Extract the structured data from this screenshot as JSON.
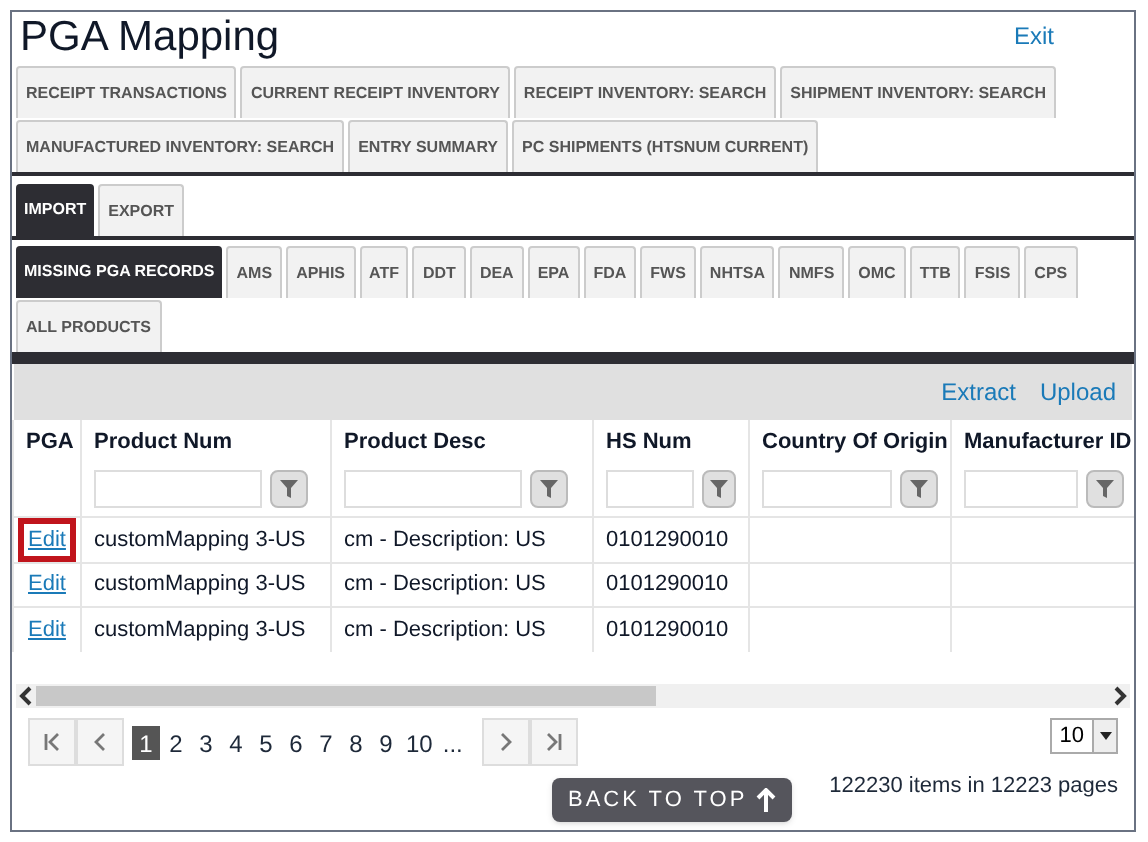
{
  "window": {
    "title": "PGA Mapping",
    "exit_link": "Exit"
  },
  "main_tabs": [
    {
      "label": "RECEIPT TRANSACTIONS",
      "selected": false
    },
    {
      "label": "CURRENT RECEIPT INVENTORY",
      "selected": false
    },
    {
      "label": "RECEIPT INVENTORY: SEARCH",
      "selected": false
    },
    {
      "label": "SHIPMENT INVENTORY: SEARCH",
      "selected": false
    },
    {
      "label": "MANUFACTURED INVENTORY: SEARCH",
      "selected": false
    },
    {
      "label": "ENTRY SUMMARY",
      "selected": false
    },
    {
      "label": "PC SHIPMENTS (HTSNUM CURRENT)",
      "selected": false
    }
  ],
  "direction_tabs": [
    {
      "label": "IMPORT",
      "selected": true
    },
    {
      "label": "EXPORT",
      "selected": false
    }
  ],
  "agency_tabs": [
    {
      "label": "MISSING PGA RECORDS",
      "selected": true
    },
    {
      "label": "AMS",
      "selected": false
    },
    {
      "label": "APHIS",
      "selected": false
    },
    {
      "label": "ATF",
      "selected": false
    },
    {
      "label": "DDT",
      "selected": false
    },
    {
      "label": "DEA",
      "selected": false
    },
    {
      "label": "EPA",
      "selected": false
    },
    {
      "label": "FDA",
      "selected": false
    },
    {
      "label": "FWS",
      "selected": false
    },
    {
      "label": "NHTSA",
      "selected": false
    },
    {
      "label": "NMFS",
      "selected": false
    },
    {
      "label": "OMC",
      "selected": false
    },
    {
      "label": "TTB",
      "selected": false
    },
    {
      "label": "FSIS",
      "selected": false
    },
    {
      "label": "CPS",
      "selected": false
    },
    {
      "label": "ALL PRODUCTS",
      "selected": false
    }
  ],
  "toolbar": {
    "links": [
      "Extract",
      "Upload"
    ]
  },
  "table": {
    "columns": [
      {
        "label": "PGA",
        "filter": false
      },
      {
        "label": "Product Num",
        "filter": true
      },
      {
        "label": "Product Desc",
        "filter": true
      },
      {
        "label": "HS Num",
        "filter": true
      },
      {
        "label": "Country Of Origin",
        "filter": true
      },
      {
        "label": "Manufacturer ID",
        "filter": true
      }
    ],
    "rows": [
      {
        "highlighted": true,
        "cells": [
          "Edit",
          "customMapping 3-US",
          "cm - Description: US",
          "0101290010",
          "",
          ""
        ]
      },
      {
        "highlighted": false,
        "cells": [
          "Edit",
          "customMapping 3-US",
          "cm - Description: US",
          "0101290010",
          "",
          ""
        ]
      },
      {
        "highlighted": false,
        "cells": [
          "Edit",
          "customMapping 3-US",
          "cm - Description: US",
          "0101290010",
          "",
          ""
        ]
      }
    ]
  },
  "pager": {
    "pages": [
      {
        "label": "1",
        "selected": true
      },
      {
        "label": "2",
        "selected": false
      },
      {
        "label": "3",
        "selected": false
      },
      {
        "label": "4",
        "selected": false
      },
      {
        "label": "5",
        "selected": false
      },
      {
        "label": "6",
        "selected": false
      },
      {
        "label": "7",
        "selected": false
      },
      {
        "label": "8",
        "selected": false
      },
      {
        "label": "9",
        "selected": false
      },
      {
        "label": "10",
        "selected": false
      },
      {
        "label": "...",
        "selected": false
      }
    ],
    "page_size": "10",
    "summary": "122230 items in 12223 pages"
  },
  "back_to_top": "BACK TO TOP"
}
